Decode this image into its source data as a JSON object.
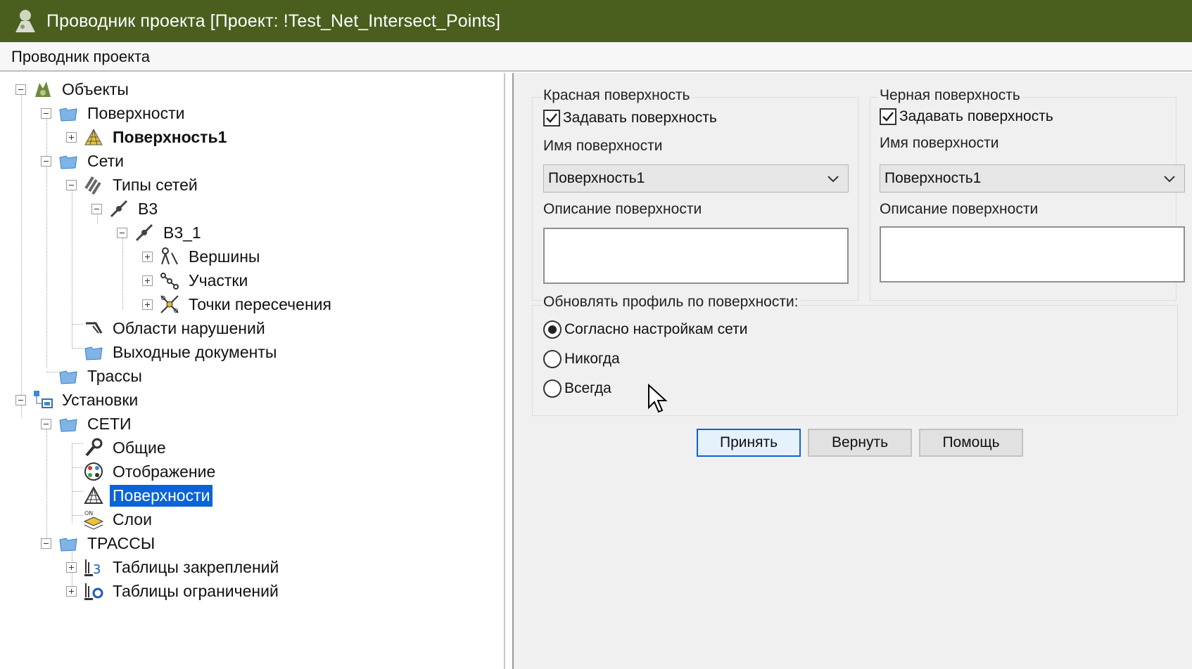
{
  "window": {
    "title": "Проводник проекта [Проект: !Test_Net_Intersect_Points]"
  },
  "menubar": {
    "label": "Проводник проекта"
  },
  "tree": {
    "objects": "Объекты",
    "surfaces": "Поверхности",
    "surface1": "Поверхность1",
    "networks": "Сети",
    "network_types": "Типы сетей",
    "v3": "В3",
    "v3_1": "В3_1",
    "vertices": "Вершины",
    "segments": "Участки",
    "intersection_points": "Точки пересечения",
    "violation_areas": "Области нарушений",
    "output_docs": "Выходные документы",
    "routes": "Трассы",
    "settings": "Установки",
    "settings_networks": "СЕТИ",
    "general": "Общие",
    "display": "Отображение",
    "settings_surfaces": "Поверхности",
    "layers": "Слои",
    "settings_routes": "ТРАССЫ",
    "staking_tables": "Таблицы закреплений",
    "constraint_tables": "Таблицы ограничений"
  },
  "red_surface": {
    "title": "Красная поверхность",
    "set_surface_label": "Задавать поверхность",
    "set_surface_checked": true,
    "name_label": "Имя поверхности",
    "name_value": "Поверхность1",
    "description_label": "Описание поверхности",
    "description_value": ""
  },
  "black_surface": {
    "title": "Черная поверхность",
    "set_surface_label": "Задавать поверхность",
    "set_surface_checked": true,
    "name_label": "Имя поверхности",
    "name_value": "Поверхность1",
    "description_label": "Описание поверхности",
    "description_value": ""
  },
  "update_profile": {
    "title": "Обновлять профиль по поверхности:",
    "options": [
      "Согласно настройкам сети",
      "Никогда",
      "Всегда"
    ],
    "selected": "Согласно настройкам сети"
  },
  "buttons": {
    "apply": "Принять",
    "revert": "Вернуть",
    "help": "Помощь"
  },
  "colors": {
    "titlebar": "#4a5f1e",
    "selection": "#0a64d8"
  }
}
